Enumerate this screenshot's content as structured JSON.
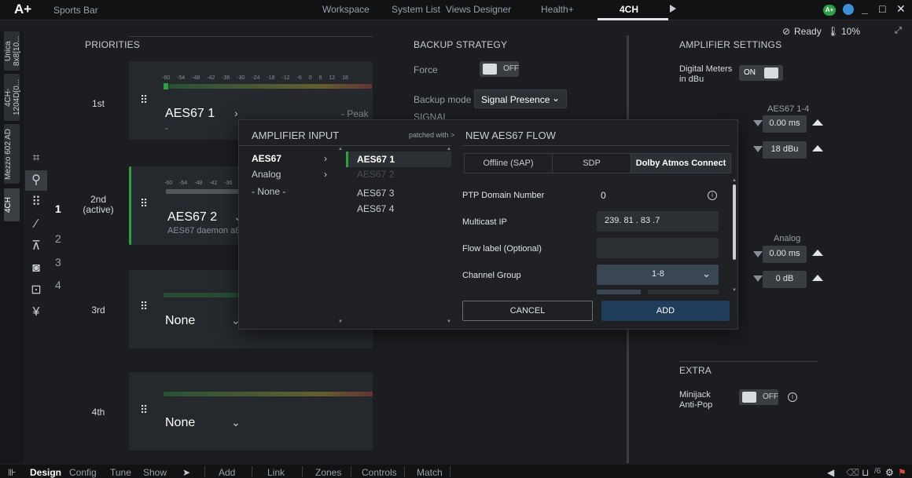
{
  "topbar": {
    "logo": "A+",
    "project": "Sports Bar",
    "nav": [
      "Workspace",
      "System List",
      "Views Designer",
      "Health+",
      "4CH"
    ],
    "badge": "A+",
    "minimize": "_",
    "maximize": "□",
    "close": "✕"
  },
  "status": {
    "ready": "Ready",
    "temp": "10%"
  },
  "vtabs": [
    "Unica 8x8[10...",
    "4CH-1204D[0...",
    "Mezzo 602 AD",
    "4CH"
  ],
  "channels": [
    "1",
    "2",
    "3",
    "4"
  ],
  "priorities": {
    "title": "PRIORITIES",
    "scale": "-60 -54 -48 -42 -36 -30 -24 -18 -12 -6 0 6 12 18",
    "scale_short": "-60 -54 -48 -42 -36",
    "cards": [
      {
        "rank": "1st",
        "title": "AES67 1",
        "sub": "-",
        "status": "- Peak"
      },
      {
        "rank": "2nd",
        "rank2": "(active)",
        "title": "AES67 2",
        "sub": "AES67 daemon a8"
      },
      {
        "rank": "3rd",
        "title": "None"
      },
      {
        "rank": "4th",
        "title": "None"
      }
    ]
  },
  "backup": {
    "title": "BACKUP STRATEGY",
    "force_label": "Force",
    "force_state": "OFF",
    "mode_label": "Backup mode",
    "mode_value": "Signal Presence",
    "signal_label": "SIGNAL"
  },
  "amp": {
    "title": "AMPLIFIER SETTINGS",
    "meters_label_1": "Digital Meters",
    "meters_label_2": "in dBu",
    "meters_state": "ON",
    "aes_group": "AES67 1-4",
    "aes_delay": "0.00 ms",
    "aes_level": "18 dBu",
    "analog_group": "Analog",
    "analog_delay": "0.00 ms",
    "analog_level": "0 dB"
  },
  "extra": {
    "title": "EXTRA",
    "minijack_1": "Minijack",
    "minijack_2": "Anti-Pop",
    "state": "OFF"
  },
  "modal": {
    "input_title": "AMPLIFIER INPUT",
    "patched": "patched with >",
    "flow_title": "NEW AES67 FLOW",
    "sources": [
      "AES67",
      "Analog",
      "- None -"
    ],
    "channels": [
      "AES67 1",
      "AES67 2",
      "AES67 3",
      "AES67 4"
    ],
    "tabs": [
      "Offline (SAP)",
      "SDP",
      "Dolby Atmos Connect"
    ],
    "ptp_label": "PTP Domain Number",
    "ptp_value": "0",
    "ip_label": "Multicast IP",
    "ip_value": "239. 81 . 83 .7",
    "flow_label": "Flow label (Optional)",
    "flow_value": "",
    "group_label": "Channel Group",
    "group_value": "1-8",
    "cancel": "CANCEL",
    "add": "ADD"
  },
  "bottom": {
    "modes": [
      "Design",
      "Config",
      "Tune",
      "Show"
    ],
    "actions": [
      "Add",
      "Link",
      "Zones",
      "Controls",
      "Match"
    ],
    "counter": "/6"
  },
  "colors": {
    "accent_green": "#2ea043",
    "add_button": "#1f3d5a"
  }
}
